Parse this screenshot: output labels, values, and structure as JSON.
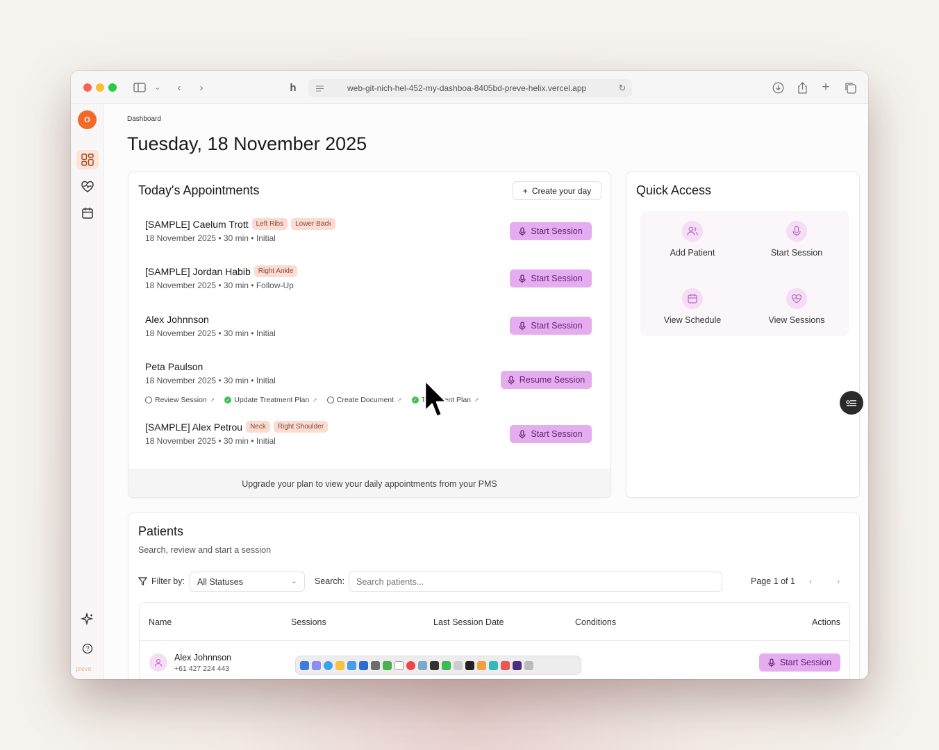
{
  "browser": {
    "url": "web-git-nich-hel-452-my-dashboa-8405bd-preve-helix.vercel.app"
  },
  "sidebar": {
    "logo_text": "O",
    "brand": "preve"
  },
  "header": {
    "breadcrumb": "Dashboard",
    "title": "Tuesday, 18 November 2025"
  },
  "appointments": {
    "title": "Today's Appointments",
    "create_label": "Create your day",
    "items": [
      {
        "name": "[SAMPLE] Caelum Trott",
        "tags": [
          "Left Ribs",
          "Lower Back"
        ],
        "meta": "18 November 2025 • 30 min • Initial",
        "action": "Start Session"
      },
      {
        "name": "[SAMPLE] Jordan Habib",
        "tags": [
          "Right Ankle"
        ],
        "meta": "18 November 2025 • 30 min • Follow-Up",
        "action": "Start Session"
      },
      {
        "name": "Alex Johnnson",
        "tags": [],
        "meta": "18 November 2025 • 30 min • Initial",
        "action": "Start Session"
      },
      {
        "name": "Peta Paulson",
        "tags": [],
        "meta": "18 November 2025 • 30 min • Initial",
        "action": "Resume Session"
      },
      {
        "name": "[SAMPLE] Alex Petrou",
        "tags": [
          "Neck",
          "Right Shoulder"
        ],
        "meta": "18 November 2025 • 30 min • Initial",
        "action": "Start Session"
      }
    ],
    "tasks": [
      {
        "label": "Review Session",
        "done": false
      },
      {
        "label": "Update Treatment Plan",
        "done": true
      },
      {
        "label": "Create Document",
        "done": false
      },
      {
        "label": "Treatment Plan",
        "done": true
      }
    ],
    "upgrade_text": "Upgrade your plan to view your daily appointments from your PMS"
  },
  "quick_access": {
    "title": "Quick Access",
    "items": [
      {
        "label": "Add Patient",
        "icon": "users-icon"
      },
      {
        "label": "Start Session",
        "icon": "mic-icon"
      },
      {
        "label": "View Schedule",
        "icon": "calendar-icon"
      },
      {
        "label": "View Sessions",
        "icon": "heart-pulse-icon"
      }
    ]
  },
  "patients": {
    "title": "Patients",
    "subtitle": "Search, review and start a session",
    "filter_label": "Filter by:",
    "filter_value": "All Statuses",
    "search_label": "Search:",
    "search_placeholder": "Search patients...",
    "page_info": "Page 1 of 1",
    "columns": [
      "Name",
      "Sessions",
      "Last Session Date",
      "Conditions",
      "Actions"
    ],
    "rows": [
      {
        "name": "Alex Johnnson",
        "phone": "+61 427 224 443",
        "action": "Start Session"
      }
    ]
  },
  "colors": {
    "accent": "#e6acf0",
    "accent_text": "#5a2570",
    "tag_bg": "#fbdcd3",
    "brand_orange": "#f06a2a"
  }
}
